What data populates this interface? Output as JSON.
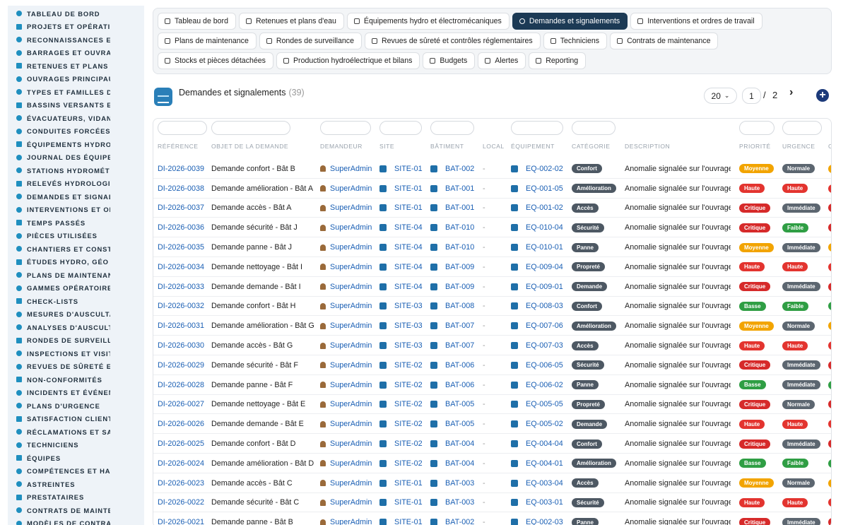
{
  "sidebar": {
    "items": [
      {
        "label": "TABLEAU DE BORD",
        "icon": "dashboard-icon"
      },
      {
        "label": "PROJETS ET OPÉRATIONS",
        "icon": "projects-icon"
      },
      {
        "label": "RECONNAISSANCES ET VISITES",
        "icon": "recon-icon"
      },
      {
        "label": "BARRAGES ET OUVRAGES",
        "icon": "dam-icon"
      },
      {
        "label": "RETENUES ET PLANS D'EAU",
        "icon": "reservoir-icon"
      },
      {
        "label": "OUVRAGES PRINCIPAUX",
        "icon": "structure-icon"
      },
      {
        "label": "TYPES ET FAMILLES D'OUVRAGES",
        "icon": "types-icon"
      },
      {
        "label": "BASSINS VERSANTS ET AFFLUENTS",
        "icon": "basin-icon"
      },
      {
        "label": "ÉVACUATEURS, VIDANGES",
        "icon": "spillway-icon"
      },
      {
        "label": "CONDUITES FORCÉES ET GALERIES",
        "icon": "penstock-icon"
      },
      {
        "label": "ÉQUIPEMENTS HYDRO ET ÉLECTROMÉCANIQUES",
        "icon": "equipment-icon"
      },
      {
        "label": "JOURNAL DES ÉQUIPEMENTS",
        "icon": "journal-icon"
      },
      {
        "label": "STATIONS HYDROMÉTRIQUES",
        "icon": "station-icon"
      },
      {
        "label": "RELEVÉS HYDROLOGIQUES",
        "icon": "readings-icon"
      },
      {
        "label": "DEMANDES ET SIGNALEMENTS",
        "icon": "requests-icon"
      },
      {
        "label": "INTERVENTIONS ET ORDRES DE TRAVAIL",
        "icon": "work-orders-icon"
      },
      {
        "label": "TEMPS PASSÉS",
        "icon": "time-icon"
      },
      {
        "label": "PIÈCES UTILISÉES",
        "icon": "parts-icon"
      },
      {
        "label": "CHANTIERS ET CONSTRUCTIONS",
        "icon": "construction-icon"
      },
      {
        "label": "ÉTUDES HYDRO, GÉO ET ENVIRONNEMENT",
        "icon": "studies-icon"
      },
      {
        "label": "PLANS DE MAINTENANCE",
        "icon": "maintenance-plan-icon"
      },
      {
        "label": "GAMMES OPÉRATOIRES",
        "icon": "procedures-icon"
      },
      {
        "label": "CHECK-LISTS",
        "icon": "checklist-icon"
      },
      {
        "label": "MESURES D'AUSCULTATION",
        "icon": "measures-icon"
      },
      {
        "label": "ANALYSES D'AUSCULTATION",
        "icon": "analyses-icon"
      },
      {
        "label": "RONDES DE SURVEILLANCE",
        "icon": "rounds-icon"
      },
      {
        "label": "INSPECTIONS ET VISITES",
        "icon": "inspections-icon"
      },
      {
        "label": "REVUES DE SÛRETÉ ET CONTRÔLES",
        "icon": "safety-reviews-icon"
      },
      {
        "label": "NON-CONFORMITÉS",
        "icon": "nonconformity-icon"
      },
      {
        "label": "INCIDENTS ET ÉVÉNEMENTS",
        "icon": "incidents-icon"
      },
      {
        "label": "PLANS D'URGENCE",
        "icon": "emergency-icon"
      },
      {
        "label": "SATISFACTION CLIENT",
        "icon": "satisfaction-icon"
      },
      {
        "label": "RÉCLAMATIONS ET SAV",
        "icon": "claims-icon"
      },
      {
        "label": "TECHNICIENS",
        "icon": "technicians-icon"
      },
      {
        "label": "ÉQUIPES",
        "icon": "teams-icon"
      },
      {
        "label": "COMPÉTENCES ET HABILITATIONS",
        "icon": "skills-icon"
      },
      {
        "label": "ASTREINTES",
        "icon": "oncall-icon"
      },
      {
        "label": "PRESTATAIRES",
        "icon": "providers-icon"
      },
      {
        "label": "CONTRATS DE MAINTENANCE",
        "icon": "contracts-icon"
      },
      {
        "label": "MODÈLES DE CONTRATS",
        "icon": "templates-icon"
      }
    ]
  },
  "tabs": [
    {
      "label": "Tableau de bord",
      "icon": "dashboard-icon",
      "active": false
    },
    {
      "label": "Retenues et plans d'eau",
      "icon": "reservoir-icon",
      "active": false
    },
    {
      "label": "Équipements hydro et électromécaniques",
      "icon": "cogs-icon",
      "active": false
    },
    {
      "label": "Demandes et signalements",
      "icon": "question-icon",
      "active": true
    },
    {
      "label": "Interventions et ordres de travail",
      "icon": "clipboard-icon",
      "active": false
    },
    {
      "label": "Plans de maintenance",
      "icon": "calendar-icon",
      "active": false
    },
    {
      "label": "Rondes de surveillance",
      "icon": "route-icon",
      "active": false
    },
    {
      "label": "Revues de sûreté et contrôles réglementaires",
      "icon": "file-check-icon",
      "active": false
    },
    {
      "label": "Techniciens",
      "icon": "hardhat-icon",
      "active": false
    },
    {
      "label": "Contrats de maintenance",
      "icon": "contract-icon",
      "active": false
    },
    {
      "label": "Stocks et pièces détachées",
      "icon": "boxes-icon",
      "active": false
    },
    {
      "label": "Production hydroélectrique et bilans",
      "icon": "bolt-icon",
      "active": false
    },
    {
      "label": "Budgets",
      "icon": "money-icon",
      "active": false
    },
    {
      "label": "Alertes",
      "icon": "bell-icon",
      "active": false
    },
    {
      "label": "Reporting",
      "icon": "pie-chart-icon",
      "active": false
    }
  ],
  "header": {
    "title": "Demandes et signalements",
    "count": "(39)"
  },
  "pagination": {
    "page_size": "20",
    "page": "1",
    "separator": "/",
    "total_pages": "2",
    "next": "›",
    "add": "+"
  },
  "table": {
    "columns": [
      "RÉFÉRENCE",
      "OBJET DE LA DEMANDE",
      "DEMANDEUR",
      "SITE",
      "BÂTIMENT",
      "LOCAL",
      "ÉQUIPEMENT",
      "CATÉGORIE",
      "DESCRIPTION",
      "PRIORITÉ",
      "URGENCE",
      "C"
    ],
    "rows": [
      {
        "ref": "DI-2026-0039",
        "objet": "Demande confort - Bât B",
        "demandeur": "SuperAdmin",
        "site": "SITE-01",
        "batiment": "BAT-002",
        "local": "-",
        "equipement": "EQ-002-02",
        "categorie": "Confort",
        "description": "Anomalie signalée sur l'ouvrage",
        "priorite": "Moyenne",
        "urgence": "Normale"
      },
      {
        "ref": "DI-2026-0038",
        "objet": "Demande amélioration - Bât A",
        "demandeur": "SuperAdmin",
        "site": "SITE-01",
        "batiment": "BAT-001",
        "local": "-",
        "equipement": "EQ-001-05",
        "categorie": "Amélioration",
        "description": "Anomalie signalée sur l'ouvrage",
        "priorite": "Haute",
        "urgence": "Haute"
      },
      {
        "ref": "DI-2026-0037",
        "objet": "Demande accès - Bât A",
        "demandeur": "SuperAdmin",
        "site": "SITE-01",
        "batiment": "BAT-001",
        "local": "-",
        "equipement": "EQ-001-02",
        "categorie": "Accès",
        "description": "Anomalie signalée sur l'ouvrage",
        "priorite": "Critique",
        "urgence": "Immédiate"
      },
      {
        "ref": "DI-2026-0036",
        "objet": "Demande sécurité - Bât J",
        "demandeur": "SuperAdmin",
        "site": "SITE-04",
        "batiment": "BAT-010",
        "local": "-",
        "equipement": "EQ-010-04",
        "categorie": "Sécurité",
        "description": "Anomalie signalée sur l'ouvrage",
        "priorite": "Critique",
        "urgence": "Faible"
      },
      {
        "ref": "DI-2026-0035",
        "objet": "Demande panne - Bât J",
        "demandeur": "SuperAdmin",
        "site": "SITE-04",
        "batiment": "BAT-010",
        "local": "-",
        "equipement": "EQ-010-01",
        "categorie": "Panne",
        "description": "Anomalie signalée sur l'ouvrage",
        "priorite": "Moyenne",
        "urgence": "Immédiate"
      },
      {
        "ref": "DI-2026-0034",
        "objet": "Demande nettoyage - Bât I",
        "demandeur": "SuperAdmin",
        "site": "SITE-04",
        "batiment": "BAT-009",
        "local": "-",
        "equipement": "EQ-009-04",
        "categorie": "Propreté",
        "description": "Anomalie signalée sur l'ouvrage",
        "priorite": "Haute",
        "urgence": "Haute"
      },
      {
        "ref": "DI-2026-0033",
        "objet": "Demande demande - Bât I",
        "demandeur": "SuperAdmin",
        "site": "SITE-04",
        "batiment": "BAT-009",
        "local": "-",
        "equipement": "EQ-009-01",
        "categorie": "Demande",
        "description": "Anomalie signalée sur l'ouvrage",
        "priorite": "Critique",
        "urgence": "Immédiate"
      },
      {
        "ref": "DI-2026-0032",
        "objet": "Demande confort - Bât H",
        "demandeur": "SuperAdmin",
        "site": "SITE-03",
        "batiment": "BAT-008",
        "local": "-",
        "equipement": "EQ-008-03",
        "categorie": "Confort",
        "description": "Anomalie signalée sur l'ouvrage",
        "priorite": "Basse",
        "urgence": "Faible"
      },
      {
        "ref": "DI-2026-0031",
        "objet": "Demande amélioration - Bât G",
        "demandeur": "SuperAdmin",
        "site": "SITE-03",
        "batiment": "BAT-007",
        "local": "-",
        "equipement": "EQ-007-06",
        "categorie": "Amélioration",
        "description": "Anomalie signalée sur l'ouvrage",
        "priorite": "Moyenne",
        "urgence": "Normale"
      },
      {
        "ref": "DI-2026-0030",
        "objet": "Demande accès - Bât G",
        "demandeur": "SuperAdmin",
        "site": "SITE-03",
        "batiment": "BAT-007",
        "local": "-",
        "equipement": "EQ-007-03",
        "categorie": "Accès",
        "description": "Anomalie signalée sur l'ouvrage",
        "priorite": "Haute",
        "urgence": "Haute"
      },
      {
        "ref": "DI-2026-0029",
        "objet": "Demande sécurité - Bât F",
        "demandeur": "SuperAdmin",
        "site": "SITE-02",
        "batiment": "BAT-006",
        "local": "-",
        "equipement": "EQ-006-05",
        "categorie": "Sécurité",
        "description": "Anomalie signalée sur l'ouvrage",
        "priorite": "Critique",
        "urgence": "Immédiate"
      },
      {
        "ref": "DI-2026-0028",
        "objet": "Demande panne - Bât F",
        "demandeur": "SuperAdmin",
        "site": "SITE-02",
        "batiment": "BAT-006",
        "local": "-",
        "equipement": "EQ-006-02",
        "categorie": "Panne",
        "description": "Anomalie signalée sur l'ouvrage",
        "priorite": "Basse",
        "urgence": "Immédiate"
      },
      {
        "ref": "DI-2026-0027",
        "objet": "Demande nettoyage - Bât E",
        "demandeur": "SuperAdmin",
        "site": "SITE-02",
        "batiment": "BAT-005",
        "local": "-",
        "equipement": "EQ-005-05",
        "categorie": "Propreté",
        "description": "Anomalie signalée sur l'ouvrage",
        "priorite": "Critique",
        "urgence": "Normale"
      },
      {
        "ref": "DI-2026-0026",
        "objet": "Demande demande - Bât E",
        "demandeur": "SuperAdmin",
        "site": "SITE-02",
        "batiment": "BAT-005",
        "local": "-",
        "equipement": "EQ-005-02",
        "categorie": "Demande",
        "description": "Anomalie signalée sur l'ouvrage",
        "priorite": "Haute",
        "urgence": "Haute"
      },
      {
        "ref": "DI-2026-0025",
        "objet": "Demande confort - Bât D",
        "demandeur": "SuperAdmin",
        "site": "SITE-02",
        "batiment": "BAT-004",
        "local": "-",
        "equipement": "EQ-004-04",
        "categorie": "Confort",
        "description": "Anomalie signalée sur l'ouvrage",
        "priorite": "Critique",
        "urgence": "Immédiate"
      },
      {
        "ref": "DI-2026-0024",
        "objet": "Demande amélioration - Bât D",
        "demandeur": "SuperAdmin",
        "site": "SITE-02",
        "batiment": "BAT-004",
        "local": "-",
        "equipement": "EQ-004-01",
        "categorie": "Amélioration",
        "description": "Anomalie signalée sur l'ouvrage",
        "priorite": "Basse",
        "urgence": "Faible"
      },
      {
        "ref": "DI-2026-0023",
        "objet": "Demande accès - Bât C",
        "demandeur": "SuperAdmin",
        "site": "SITE-01",
        "batiment": "BAT-003",
        "local": "-",
        "equipement": "EQ-003-04",
        "categorie": "Accès",
        "description": "Anomalie signalée sur l'ouvrage",
        "priorite": "Moyenne",
        "urgence": "Normale"
      },
      {
        "ref": "DI-2026-0022",
        "objet": "Demande sécurité - Bât C",
        "demandeur": "SuperAdmin",
        "site": "SITE-01",
        "batiment": "BAT-003",
        "local": "-",
        "equipement": "EQ-003-01",
        "categorie": "Sécurité",
        "description": "Anomalie signalée sur l'ouvrage",
        "priorite": "Haute",
        "urgence": "Haute"
      },
      {
        "ref": "DI-2026-0021",
        "objet": "Demande panne - Bât B",
        "demandeur": "SuperAdmin",
        "site": "SITE-01",
        "batiment": "BAT-002",
        "local": "-",
        "equipement": "EQ-002-03",
        "categorie": "Panne",
        "description": "Anomalie signalée sur l'ouvrage",
        "priorite": "Critique",
        "urgence": "Immédiate"
      }
    ]
  },
  "colors": {
    "accent": "#1c3a55",
    "link": "#1a5fb4",
    "Moyenne": "#f2a400",
    "Haute": "#e3342f",
    "Critique": "#d62a2a",
    "Basse": "#2f9e44",
    "Normale": "#5c6670",
    "Immédiate": "#5c6670",
    "Faible": "#2f9e44"
  }
}
